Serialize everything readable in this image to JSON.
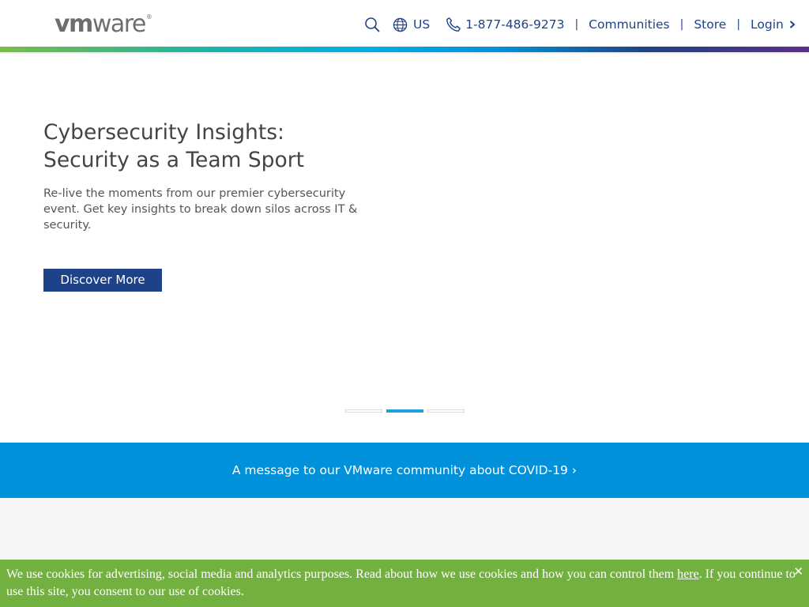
{
  "header": {
    "logo": {
      "vm": "vm",
      "ware": "ware",
      "reg": "®"
    },
    "nav": {
      "region_label": "US",
      "phone": "1-877-486-9273",
      "communities": "Communities",
      "store": "Store",
      "login": "Login",
      "separator": "|"
    },
    "icons": [
      "search-icon",
      "globe-icon",
      "phone-icon",
      "chevron-right-icon"
    ]
  },
  "hero": {
    "title_line1": "Cybersecurity Insights:",
    "title_line2": "Security as a Team Sport",
    "description": "Re-live the moments from our premier cybersecurity event. Get key insights to break down silos across IT & security.",
    "button_label": "Discover More",
    "carousel": {
      "slide_count": 3,
      "active_index": 1
    }
  },
  "covid_banner": {
    "text": "A message to our VMware community about COVID-19",
    "chevron": "›"
  },
  "cookie_bar": {
    "text_before": "We use cookies for advertising, social media and analytics purposes. Read about how we use cookies and how you can control them ",
    "link_text": "here",
    "text_after": ". If you continue to use this site, you consent to our use of cookies.",
    "close": "✕"
  },
  "colors": {
    "brand_blue": "#1d428a",
    "banner_blue": "#0091da",
    "cookie_green": "#72b13f",
    "carousel_active": "#1ea0da"
  }
}
